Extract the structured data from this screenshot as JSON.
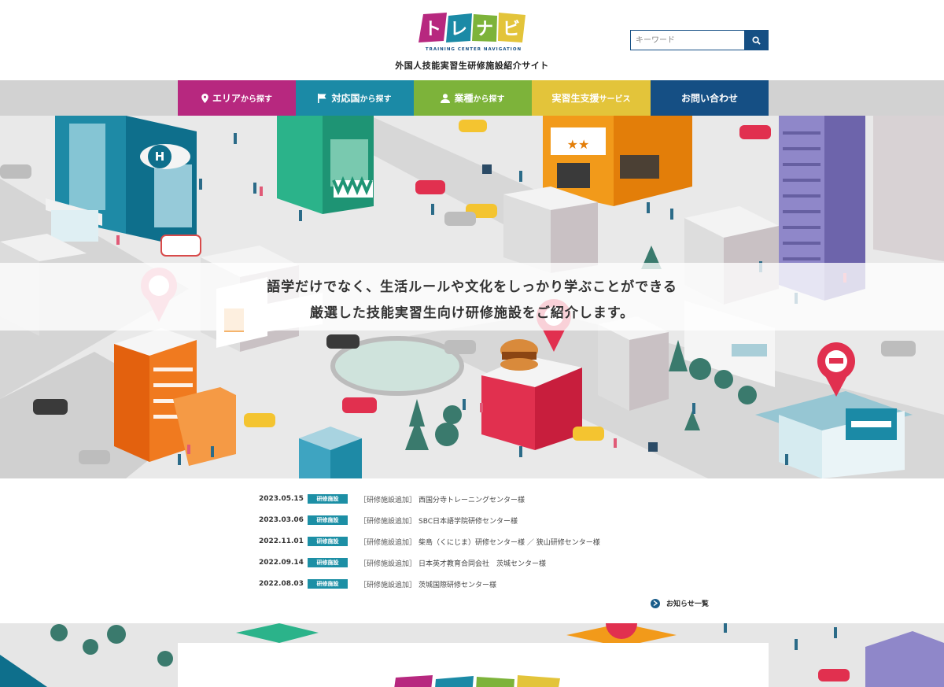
{
  "header": {
    "logo_text": "トレナビ",
    "logo_tagline": "TRAINING CENTER NAVIGATION",
    "subtitle": "外国人技能実習生研修施設紹介サイト"
  },
  "search": {
    "placeholder": "キーワード",
    "icon": "search-icon"
  },
  "nav": {
    "items": [
      {
        "main": "エリア",
        "small": "から探す",
        "color": "#b7287f",
        "icon": "map-pin-icon"
      },
      {
        "main": "対応国",
        "small": "から探す",
        "color": "#1b8aa6",
        "icon": "flag-icon"
      },
      {
        "main": "業種",
        "small": "から探す",
        "color": "#7db33a",
        "icon": "person-icon"
      },
      {
        "main": "実習生支援",
        "small": "サービス",
        "color": "#e3c43a"
      },
      {
        "main": "お問い合わせ",
        "small": "",
        "color": "#154f84"
      }
    ]
  },
  "hero": {
    "line1": "語学だけでなく、生活ルールや文化をしっかり学ぶことができる",
    "line2": "厳選した技能実習生向け研修施設をご紹介します。"
  },
  "news": {
    "items": [
      {
        "date": "2023.05.15",
        "badge": "研修施設",
        "category": "［研修施設追加］",
        "title": "西国分寺トレーニングセンター様"
      },
      {
        "date": "2023.03.06",
        "badge": "研修施設",
        "category": "［研修施設追加］",
        "title": "SBC日本語学院研修センター様"
      },
      {
        "date": "2022.11.01",
        "badge": "研修施設",
        "category": "［研修施設追加］",
        "title": "柴島（くにじま）研修センター様 ／ 狭山研修センター様"
      },
      {
        "date": "2022.09.14",
        "badge": "研修施設",
        "category": "［研修施設追加］",
        "title": "日本英才教育合同会社　茨城センター様"
      },
      {
        "date": "2022.08.03",
        "badge": "研修施設",
        "category": "［研修施設追加］",
        "title": "茨城国際研修センター様"
      }
    ],
    "more_label": "お知らせ一覧"
  },
  "colors": {
    "brand_navy": "#154f84",
    "badge_teal": "#1c8fa5",
    "logo_magenta": "#b7287f",
    "logo_teal": "#1b8aa6",
    "logo_green": "#7db33a",
    "logo_yellow": "#e3c43a"
  }
}
